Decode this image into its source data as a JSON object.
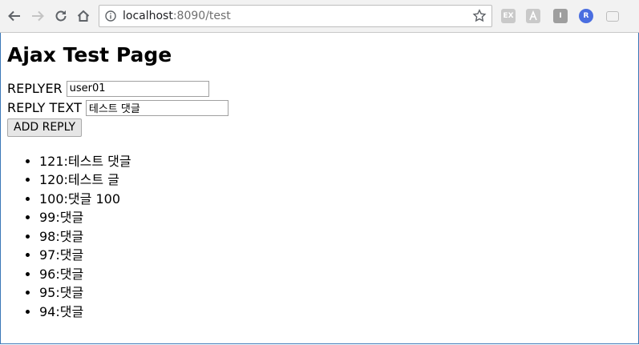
{
  "browser": {
    "url_host": "localhost",
    "url_rest": ":8090/test"
  },
  "extensions": [
    {
      "name": "ext-ex-icon",
      "label": "EX",
      "color": "#c9c9c9"
    },
    {
      "name": "ext-pdf-icon",
      "label": "",
      "color": "#c9c9c9"
    },
    {
      "name": "ext-i-icon",
      "label": "I",
      "color": "#9e9e9e"
    },
    {
      "name": "ext-r-icon",
      "label": "R",
      "color": "#4a6ee0"
    },
    {
      "name": "ext-cast-icon",
      "label": "",
      "color": "#c9c9c9"
    }
  ],
  "page": {
    "title": "Ajax Test Page",
    "replyer_label": "REPLYER",
    "replyer_value": "user01",
    "reply_text_label": "REPLY TEXT",
    "reply_text_value": "테스트 댓글",
    "add_button": "ADD REPLY",
    "replies": [
      "121:테스트 댓글",
      "120:테스트 글",
      "100:댓글 100",
      "99:댓글",
      "98:댓글",
      "97:댓글",
      "96:댓글",
      "95:댓글",
      "94:댓글"
    ]
  }
}
